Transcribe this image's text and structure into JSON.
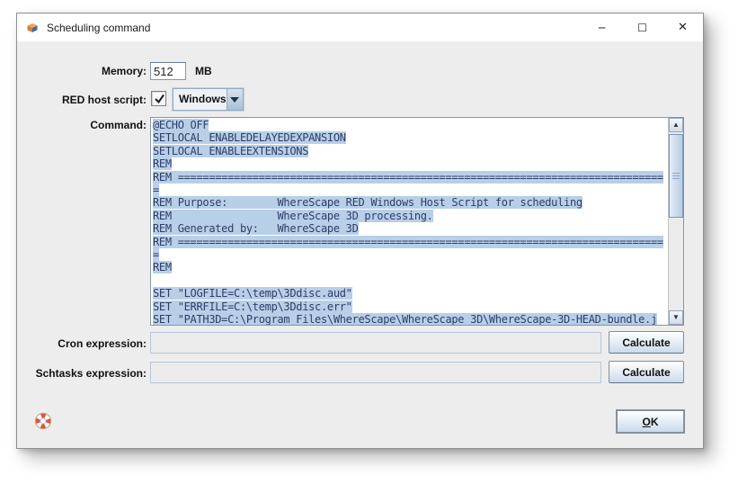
{
  "window": {
    "title": "Scheduling command",
    "app_icon": "wherescape-3d-app-icon",
    "controls": {
      "minimize": "─",
      "maximize": "☐",
      "close": "✕"
    }
  },
  "form": {
    "memory": {
      "label": "Memory:",
      "value": "512",
      "unit": "MB"
    },
    "red_host_script": {
      "label": "RED host script:",
      "checked": true,
      "selected_option": "Windows"
    },
    "command": {
      "label": "Command:",
      "lines": [
        "@ECHO OFF",
        "SETLOCAL ENABLEDELAYEDEXPANSION",
        "SETLOCAL ENABLEEXTENSIONS",
        "REM",
        "REM ==============================================================================",
        "=",
        "REM Purpose:        WhereScape RED Windows Host Script for scheduling",
        "REM                 WhereScape 3D processing.",
        "REM Generated by:   WhereScape 3D",
        "REM ==============================================================================",
        "=",
        "REM",
        "",
        "SET \"LOGFILE=C:\\temp\\3Ddisc.aud\"",
        "SET \"ERRFILE=C:\\temp\\3Ddisc.err\"",
        "SET \"PATH3D=C:\\Program Files\\WhereScape\\WhereScape 3D\\WhereScape-3D-HEAD-bundle.j"
      ]
    },
    "cron": {
      "label": "Cron expression:",
      "value": "",
      "button_label": "Calculate"
    },
    "schtasks": {
      "label": "Schtasks expression:",
      "value": "",
      "button_label": "Calculate"
    }
  },
  "scrollbar": {
    "up": "▲",
    "down": "▼"
  },
  "footer": {
    "ok_mnemonic": "O",
    "ok_rest": "K",
    "help_icon": "lifebuoy-icon"
  },
  "colors": {
    "dialog_bg": "#ededed",
    "titlebar_bg": "#ffffff",
    "selection_bg": "#b8cfe8",
    "command_text": "#2e3d68",
    "button_gradient_bottom": "#cadbec",
    "combo_border": "#94aabf"
  }
}
